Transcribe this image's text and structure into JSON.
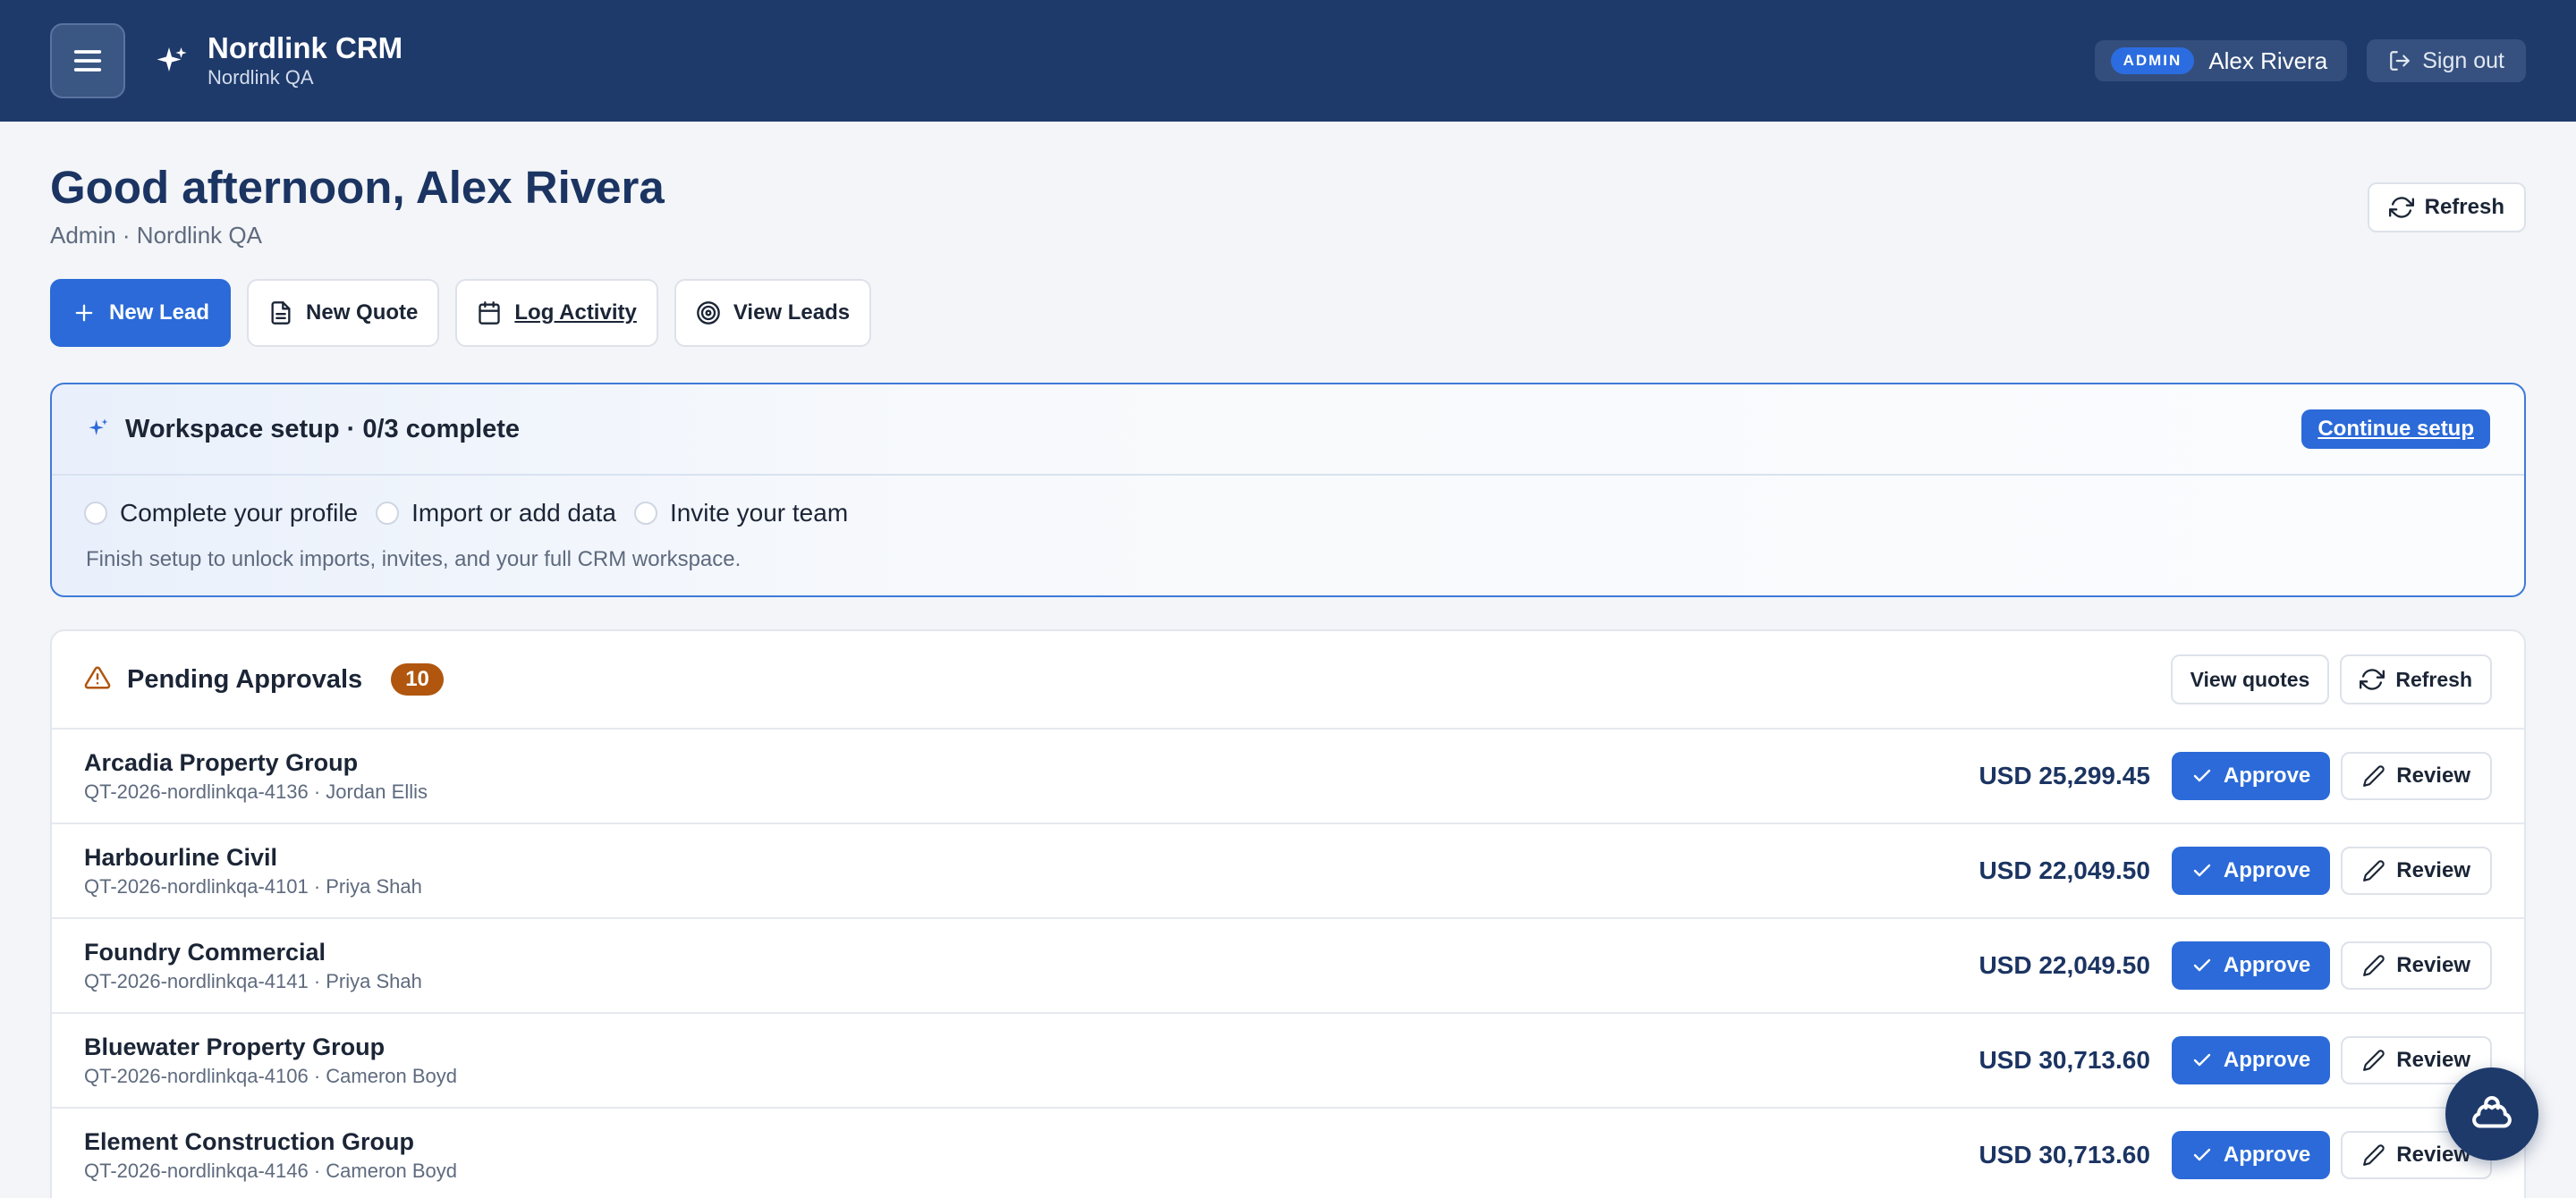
{
  "header": {
    "app_title": "Nordlink CRM",
    "workspace": "Nordlink QA",
    "role_badge": "ADMIN",
    "user_name": "Alex Rivera",
    "sign_out_label": "Sign out"
  },
  "greeting": {
    "title": "Good afternoon, Alex Rivera",
    "subtitle": "Admin · Nordlink QA",
    "refresh_label": "Refresh"
  },
  "quick_actions": [
    {
      "label": "New Lead",
      "icon": "plus-icon"
    },
    {
      "label": "New Quote",
      "icon": "document-icon"
    },
    {
      "label": "Log Activity",
      "icon": "calendar-icon"
    },
    {
      "label": "View Leads",
      "icon": "target-icon"
    }
  ],
  "setup": {
    "title": "Workspace setup · 0/3 complete",
    "continue_label": "Continue setup",
    "steps": [
      "Complete your profile",
      "Import or add data",
      "Invite your team"
    ],
    "note": "Finish setup to unlock imports, invites, and your full CRM workspace."
  },
  "approvals": {
    "title": "Pending Approvals",
    "count": "10",
    "view_quotes_label": "View quotes",
    "refresh_label": "Refresh",
    "approve_label": "Approve",
    "review_label": "Review",
    "rows": [
      {
        "name": "Arcadia Property Group",
        "meta": "QT-2026-nordlinkqa-4136 · Jordan Ellis",
        "amount": "USD 25,299.45"
      },
      {
        "name": "Harbourline Civil",
        "meta": "QT-2026-nordlinkqa-4101 · Priya Shah",
        "amount": "USD 22,049.50"
      },
      {
        "name": "Foundry Commercial",
        "meta": "QT-2026-nordlinkqa-4141 · Priya Shah",
        "amount": "USD 22,049.50"
      },
      {
        "name": "Bluewater Property Group",
        "meta": "QT-2026-nordlinkqa-4106 · Cameron Boyd",
        "amount": "USD 30,713.60"
      },
      {
        "name": "Element Construction Group",
        "meta": "QT-2026-nordlinkqa-4146 · Cameron Boyd",
        "amount": "USD 30,713.60"
      }
    ]
  },
  "colors": {
    "header_bg": "#1e3a6b",
    "primary": "#2b6ad8",
    "badge_warning": "#b0560e",
    "setup_border": "#3f7ad8"
  }
}
